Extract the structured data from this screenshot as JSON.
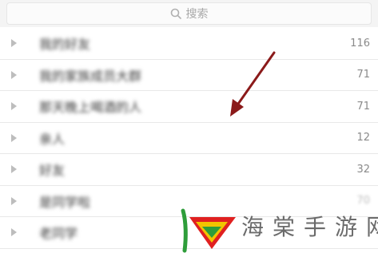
{
  "search": {
    "placeholder": "搜索"
  },
  "groups": [
    {
      "name": "我的好友",
      "count": "116",
      "blur": true
    },
    {
      "name": "我的家族成员大群",
      "count": "71",
      "blur": true
    },
    {
      "name": "那天晚上喝酒的人",
      "count": "71",
      "blur": true
    },
    {
      "name": "亲人",
      "count": "12",
      "blur": true
    },
    {
      "name": "好友",
      "count": "32",
      "blur": true
    },
    {
      "name": "是同学啦",
      "count": "70",
      "blur": true
    },
    {
      "name": "老同学",
      "count": "",
      "blur": true
    }
  ],
  "watermark": {
    "chars": [
      "海",
      "棠",
      "手",
      "游",
      "网"
    ]
  },
  "colors": {
    "accent_arrow": "#8b1a1a",
    "logo_red": "#e02020",
    "logo_yellow": "#f2c400",
    "logo_green": "#2e9d3a"
  }
}
